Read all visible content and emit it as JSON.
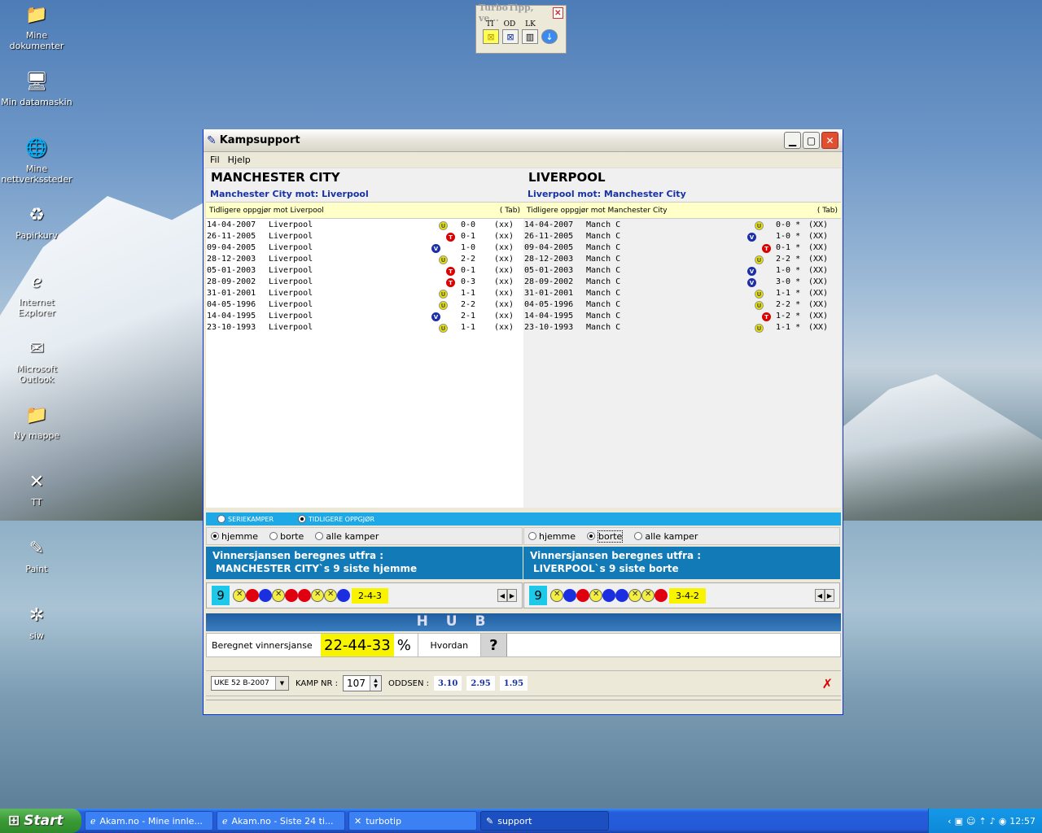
{
  "desktop": {
    "icons": [
      {
        "label": "Mine dokumenter",
        "icon": "folder-docs-icon"
      },
      {
        "label": "Min datamaskin",
        "icon": "computer-icon"
      },
      {
        "label": "Mine nettverkssteder",
        "icon": "network-icon"
      },
      {
        "label": "Papirkurv",
        "icon": "recycle-bin-icon"
      },
      {
        "label": "Internet Explorer",
        "icon": "ie-icon"
      },
      {
        "label": "Microsoft Outlook",
        "icon": "outlook-icon"
      },
      {
        "label": "Ny mappe",
        "icon": "folder-icon"
      },
      {
        "label": "TT",
        "icon": "tt-shortcut-icon"
      },
      {
        "label": "Paint",
        "icon": "paint-icon"
      },
      {
        "label": "siw",
        "icon": "siw-icon"
      }
    ]
  },
  "turbotipp": {
    "title": "TurboTipp, ve...",
    "labels": [
      "TI",
      "OD",
      "LK"
    ]
  },
  "window": {
    "title": "Kampsupport",
    "menu": [
      "Fil",
      "Hjelp"
    ]
  },
  "home": {
    "name": "MANCHESTER CITY",
    "subtitle": "Manchester City mot: Liverpool",
    "prev_header": "Tidligere oppgjør mot Liverpool",
    "tab": "( Tab)",
    "matches": [
      {
        "date": "14-04-2007",
        "opp": "Liverpool",
        "r": "U",
        "score": "0-0",
        "xx": "(xx)"
      },
      {
        "date": "26-11-2005",
        "opp": "Liverpool",
        "r": "T",
        "score": "0-1",
        "xx": "(xx)"
      },
      {
        "date": "09-04-2005",
        "opp": "Liverpool",
        "r": "V",
        "score": "1-0",
        "xx": "(xx)"
      },
      {
        "date": "28-12-2003",
        "opp": "Liverpool",
        "r": "U",
        "score": "2-2",
        "xx": "(xx)"
      },
      {
        "date": "05-01-2003",
        "opp": "Liverpool",
        "r": "T",
        "score": "0-1",
        "xx": "(xx)"
      },
      {
        "date": "28-09-2002",
        "opp": "Liverpool",
        "r": "T",
        "score": "0-3",
        "xx": "(xx)"
      },
      {
        "date": "31-01-2001",
        "opp": "Liverpool",
        "r": "U",
        "score": "1-1",
        "xx": "(xx)"
      },
      {
        "date": "04-05-1996",
        "opp": "Liverpool",
        "r": "U",
        "score": "2-2",
        "xx": "(xx)"
      },
      {
        "date": "14-04-1995",
        "opp": "Liverpool",
        "r": "V",
        "score": "2-1",
        "xx": "(xx)"
      },
      {
        "date": "23-10-1993",
        "opp": "Liverpool",
        "r": "U",
        "score": "1-1",
        "xx": "(xx)"
      }
    ],
    "filter": {
      "hjemme": "hjemme",
      "borte": "borte",
      "alle": "alle kamper",
      "selected": "hjemme"
    },
    "vinner_line1": "Vinnersjansen beregnes utfra :",
    "vinner_line2": "MANCHESTER CITY`s 9 siste hjemme",
    "form_count": "9",
    "form": [
      "U",
      "T",
      "V",
      "U",
      "T",
      "T",
      "U",
      "U",
      "V"
    ],
    "form_summary": "2-4-3"
  },
  "away": {
    "name": "LIVERPOOL",
    "subtitle": "Liverpool mot: Manchester City",
    "prev_header": "Tidligere oppgjør mot Manchester City",
    "tab": "( Tab)",
    "matches": [
      {
        "date": "14-04-2007",
        "opp": "Manch C",
        "r": "U",
        "score": "0-0 *",
        "xx": "(XX)"
      },
      {
        "date": "26-11-2005",
        "opp": "Manch C",
        "r": "V",
        "score": "1-0 *",
        "xx": "(XX)"
      },
      {
        "date": "09-04-2005",
        "opp": "Manch C",
        "r": "T",
        "score": "0-1 *",
        "xx": "(XX)"
      },
      {
        "date": "28-12-2003",
        "opp": "Manch C",
        "r": "U",
        "score": "2-2 *",
        "xx": "(XX)"
      },
      {
        "date": "05-01-2003",
        "opp": "Manch C",
        "r": "V",
        "score": "1-0 *",
        "xx": "(XX)"
      },
      {
        "date": "28-09-2002",
        "opp": "Manch C",
        "r": "V",
        "score": "3-0 *",
        "xx": "(XX)"
      },
      {
        "date": "31-01-2001",
        "opp": "Manch C",
        "r": "U",
        "score": "1-1 *",
        "xx": "(XX)"
      },
      {
        "date": "04-05-1996",
        "opp": "Manch C",
        "r": "U",
        "score": "2-2 *",
        "xx": "(XX)"
      },
      {
        "date": "14-04-1995",
        "opp": "Manch C",
        "r": "T",
        "score": "1-2 *",
        "xx": "(XX)"
      },
      {
        "date": "23-10-1993",
        "opp": "Manch C",
        "r": "U",
        "score": "1-1 *",
        "xx": "(XX)"
      }
    ],
    "filter": {
      "hjemme": "hjemme",
      "borte": "borte",
      "alle": "alle kamper",
      "selected": "borte"
    },
    "vinner_line1": "Vinnersjansen beregnes utfra :",
    "vinner_line2": "LIVERPOOL`s 9 siste borte",
    "form_count": "9",
    "form": [
      "U",
      "V",
      "T",
      "U",
      "V",
      "V",
      "U",
      "U",
      "T"
    ],
    "form_summary": "3-4-2"
  },
  "mode": {
    "seriekamper": "SERIEKAMPER",
    "tidligere": "TIDLIGERE OPPGJØR",
    "selected": "tidligere"
  },
  "hub": {
    "title": "H U B",
    "label": "Beregnet vinnersjanse",
    "value": "22-44-33",
    "pct": "%",
    "hvordan": "Hvordan",
    "help": "?"
  },
  "bottom": {
    "week": "UKE 52 B-2007",
    "kamp_label": "KAMP  NR :",
    "kamp_nr": "107",
    "odds_label": "ODDSEN :",
    "odds": [
      "3.10",
      "2.95",
      "1.95"
    ],
    "close": "✗"
  },
  "taskbar": {
    "start": "Start",
    "tasks": [
      {
        "label": "Akam.no - Mine innle...",
        "icon": "ie-icon"
      },
      {
        "label": "Akam.no - Siste 24 ti...",
        "icon": "ie-icon"
      },
      {
        "label": "turbotip",
        "icon": "tt-icon"
      },
      {
        "label": "support",
        "icon": "kampsupport-icon"
      }
    ],
    "clock": "12:57"
  },
  "colors": {
    "win": "#T00d00",
    "tie": "#e6e000",
    "loss": "#1d2fa8",
    "accent": "#137ab8"
  }
}
